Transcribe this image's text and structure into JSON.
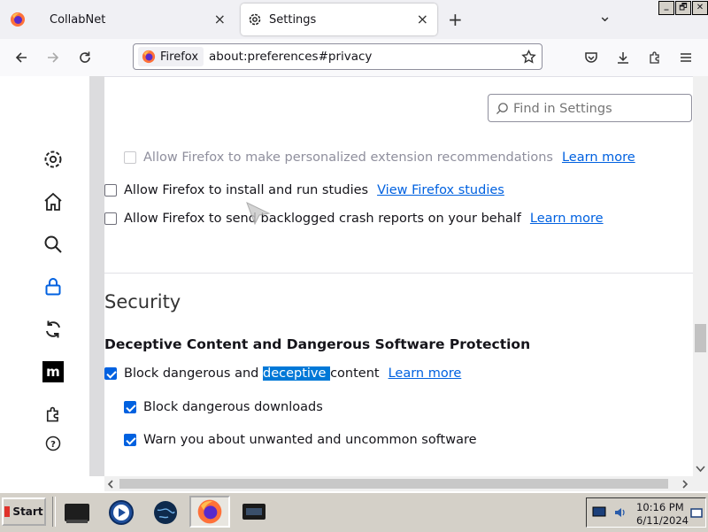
{
  "browser": {
    "tabs": [
      {
        "title": "CollabNet",
        "close": "×"
      },
      {
        "title": "Settings",
        "close": "×"
      }
    ],
    "new_tab": "+",
    "list_tabs": "⌄",
    "window_controls": [
      "_",
      "🗗",
      "✕"
    ],
    "identity_label": "Firefox",
    "url": "about:preferences#privacy"
  },
  "search": {
    "placeholder": "Find in Settings"
  },
  "sidebar": {
    "categories": [
      {
        "icon": "gear-icon",
        "label": "General"
      },
      {
        "icon": "home-icon",
        "label": "Home"
      },
      {
        "icon": "search-icon",
        "label": "Search"
      },
      {
        "icon": "lock-icon",
        "label": "Privacy & Security"
      },
      {
        "icon": "sync-icon",
        "label": "Sync"
      },
      {
        "icon": "mozilla-icon",
        "label": "More from Mozilla"
      },
      {
        "icon": "puzzle-icon",
        "label": "Extensions & Themes"
      },
      {
        "icon": "help-icon",
        "label": "Firefox Support"
      }
    ]
  },
  "data_collection": {
    "recommendations": {
      "label": "Allow Firefox to make personalized extension recommendations",
      "link": "Learn more",
      "checked": false,
      "disabled": true
    },
    "studies": {
      "label": "Allow Firefox to install and run studies",
      "link": "View Firefox studies",
      "checked": false
    },
    "crash_reports": {
      "label": "Allow Firefox to send backlogged crash reports on your behalf",
      "link": "Learn more",
      "checked": false
    }
  },
  "security": {
    "heading": "Security",
    "subheading": "Deceptive Content and Dangerous Software Protection",
    "block_deceptive": {
      "prefix": "Block dangerous and ",
      "highlighted": "deceptive ",
      "suffix": "content",
      "link": "Learn more",
      "checked": true
    },
    "block_downloads": {
      "label": "Block dangerous downloads",
      "checked": true
    },
    "warn_unwanted": {
      "label": "Warn you about unwanted and uncommon software",
      "checked": true
    }
  },
  "taskbar": {
    "start_label": "Start",
    "time": "10:16 PM",
    "date": "6/11/2024"
  },
  "colors": {
    "accent": "#0061e0",
    "highlight": "#0078d7",
    "taskbar": "#d4d0c8"
  }
}
